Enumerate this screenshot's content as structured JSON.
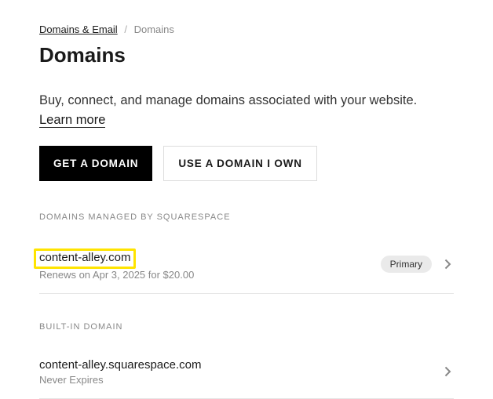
{
  "breadcrumb": {
    "root": "Domains & Email",
    "current": "Domains"
  },
  "page_title": "Domains",
  "description_text": "Buy, connect, and manage domains associated with your website.",
  "learn_more_label": "Learn more",
  "buttons": {
    "get_domain": "GET A DOMAIN",
    "use_domain": "USE A DOMAIN I OWN"
  },
  "sections": {
    "managed_label": "DOMAINS MANAGED BY SQUARESPACE",
    "builtin_label": "BUILT-IN DOMAIN"
  },
  "managed_domain": {
    "name": "content-alley.com",
    "sub": "Renews on Apr 3, 2025 for $20.00",
    "badge": "Primary"
  },
  "builtin_domain": {
    "name": "content-alley.squarespace.com",
    "sub": "Never Expires"
  }
}
